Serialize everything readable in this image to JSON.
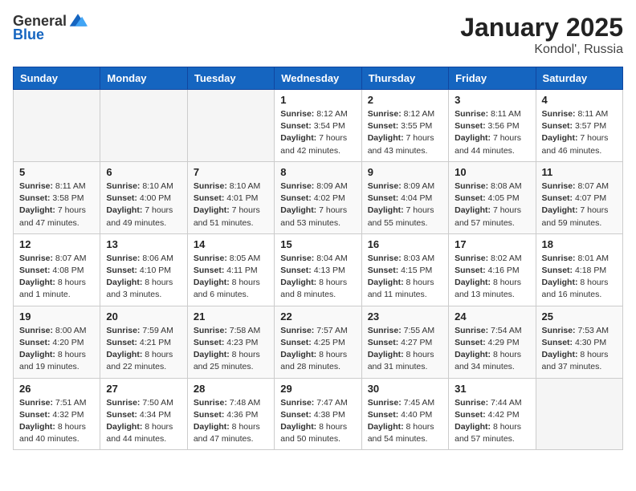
{
  "header": {
    "logo_general": "General",
    "logo_blue": "Blue",
    "month_title": "January 2025",
    "location": "Kondol', Russia"
  },
  "weekdays": [
    "Sunday",
    "Monday",
    "Tuesday",
    "Wednesday",
    "Thursday",
    "Friday",
    "Saturday"
  ],
  "weeks": [
    [
      {
        "day": "",
        "info": ""
      },
      {
        "day": "",
        "info": ""
      },
      {
        "day": "",
        "info": ""
      },
      {
        "day": "1",
        "info": "Sunrise: 8:12 AM\nSunset: 3:54 PM\nDaylight: 7 hours and 42 minutes."
      },
      {
        "day": "2",
        "info": "Sunrise: 8:12 AM\nSunset: 3:55 PM\nDaylight: 7 hours and 43 minutes."
      },
      {
        "day": "3",
        "info": "Sunrise: 8:11 AM\nSunset: 3:56 PM\nDaylight: 7 hours and 44 minutes."
      },
      {
        "day": "4",
        "info": "Sunrise: 8:11 AM\nSunset: 3:57 PM\nDaylight: 7 hours and 46 minutes."
      }
    ],
    [
      {
        "day": "5",
        "info": "Sunrise: 8:11 AM\nSunset: 3:58 PM\nDaylight: 7 hours and 47 minutes."
      },
      {
        "day": "6",
        "info": "Sunrise: 8:10 AM\nSunset: 4:00 PM\nDaylight: 7 hours and 49 minutes."
      },
      {
        "day": "7",
        "info": "Sunrise: 8:10 AM\nSunset: 4:01 PM\nDaylight: 7 hours and 51 minutes."
      },
      {
        "day": "8",
        "info": "Sunrise: 8:09 AM\nSunset: 4:02 PM\nDaylight: 7 hours and 53 minutes."
      },
      {
        "day": "9",
        "info": "Sunrise: 8:09 AM\nSunset: 4:04 PM\nDaylight: 7 hours and 55 minutes."
      },
      {
        "day": "10",
        "info": "Sunrise: 8:08 AM\nSunset: 4:05 PM\nDaylight: 7 hours and 57 minutes."
      },
      {
        "day": "11",
        "info": "Sunrise: 8:07 AM\nSunset: 4:07 PM\nDaylight: 7 hours and 59 minutes."
      }
    ],
    [
      {
        "day": "12",
        "info": "Sunrise: 8:07 AM\nSunset: 4:08 PM\nDaylight: 8 hours and 1 minute."
      },
      {
        "day": "13",
        "info": "Sunrise: 8:06 AM\nSunset: 4:10 PM\nDaylight: 8 hours and 3 minutes."
      },
      {
        "day": "14",
        "info": "Sunrise: 8:05 AM\nSunset: 4:11 PM\nDaylight: 8 hours and 6 minutes."
      },
      {
        "day": "15",
        "info": "Sunrise: 8:04 AM\nSunset: 4:13 PM\nDaylight: 8 hours and 8 minutes."
      },
      {
        "day": "16",
        "info": "Sunrise: 8:03 AM\nSunset: 4:15 PM\nDaylight: 8 hours and 11 minutes."
      },
      {
        "day": "17",
        "info": "Sunrise: 8:02 AM\nSunset: 4:16 PM\nDaylight: 8 hours and 13 minutes."
      },
      {
        "day": "18",
        "info": "Sunrise: 8:01 AM\nSunset: 4:18 PM\nDaylight: 8 hours and 16 minutes."
      }
    ],
    [
      {
        "day": "19",
        "info": "Sunrise: 8:00 AM\nSunset: 4:20 PM\nDaylight: 8 hours and 19 minutes."
      },
      {
        "day": "20",
        "info": "Sunrise: 7:59 AM\nSunset: 4:21 PM\nDaylight: 8 hours and 22 minutes."
      },
      {
        "day": "21",
        "info": "Sunrise: 7:58 AM\nSunset: 4:23 PM\nDaylight: 8 hours and 25 minutes."
      },
      {
        "day": "22",
        "info": "Sunrise: 7:57 AM\nSunset: 4:25 PM\nDaylight: 8 hours and 28 minutes."
      },
      {
        "day": "23",
        "info": "Sunrise: 7:55 AM\nSunset: 4:27 PM\nDaylight: 8 hours and 31 minutes."
      },
      {
        "day": "24",
        "info": "Sunrise: 7:54 AM\nSunset: 4:29 PM\nDaylight: 8 hours and 34 minutes."
      },
      {
        "day": "25",
        "info": "Sunrise: 7:53 AM\nSunset: 4:30 PM\nDaylight: 8 hours and 37 minutes."
      }
    ],
    [
      {
        "day": "26",
        "info": "Sunrise: 7:51 AM\nSunset: 4:32 PM\nDaylight: 8 hours and 40 minutes."
      },
      {
        "day": "27",
        "info": "Sunrise: 7:50 AM\nSunset: 4:34 PM\nDaylight: 8 hours and 44 minutes."
      },
      {
        "day": "28",
        "info": "Sunrise: 7:48 AM\nSunset: 4:36 PM\nDaylight: 8 hours and 47 minutes."
      },
      {
        "day": "29",
        "info": "Sunrise: 7:47 AM\nSunset: 4:38 PM\nDaylight: 8 hours and 50 minutes."
      },
      {
        "day": "30",
        "info": "Sunrise: 7:45 AM\nSunset: 4:40 PM\nDaylight: 8 hours and 54 minutes."
      },
      {
        "day": "31",
        "info": "Sunrise: 7:44 AM\nSunset: 4:42 PM\nDaylight: 8 hours and 57 minutes."
      },
      {
        "day": "",
        "info": ""
      }
    ]
  ]
}
